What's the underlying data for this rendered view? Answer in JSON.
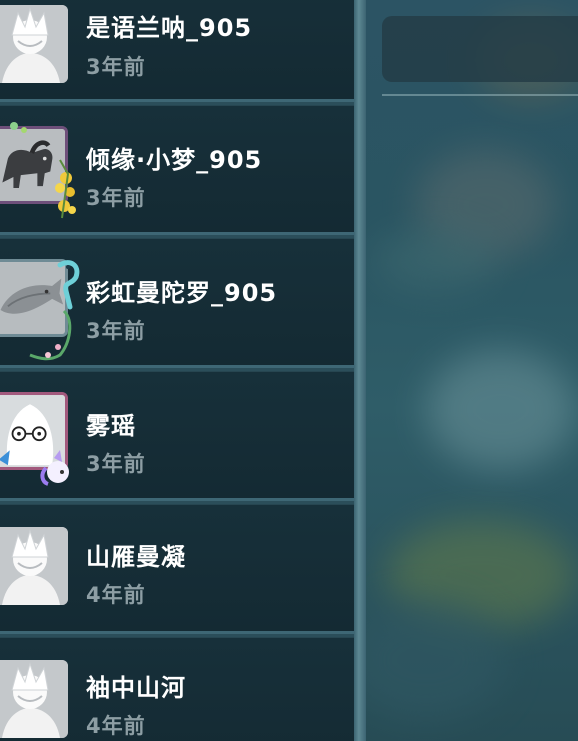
{
  "friends": [
    {
      "name": "是语兰呐_905",
      "time": "3年前"
    },
    {
      "name": "倾缘·小梦_905",
      "time": "3年前"
    },
    {
      "name": "彩虹曼陀罗_905",
      "time": "3年前"
    },
    {
      "name": "雾瑶",
      "time": "3年前"
    },
    {
      "name": "山雁曼凝",
      "time": "4年前"
    },
    {
      "name": "袖中山河",
      "time": "4年前"
    }
  ],
  "icons": {
    "default_avatar": "default-avatar-icon",
    "horse_avatar": "horse-avatar-icon",
    "fish_avatar": "fish-avatar-icon",
    "ghost_avatar": "ghost-avatar-icon"
  },
  "colors": {
    "row_bg": "#152c35",
    "row_border": "#3e6775",
    "name": "#ffffff",
    "time": "#8d9ea4"
  }
}
